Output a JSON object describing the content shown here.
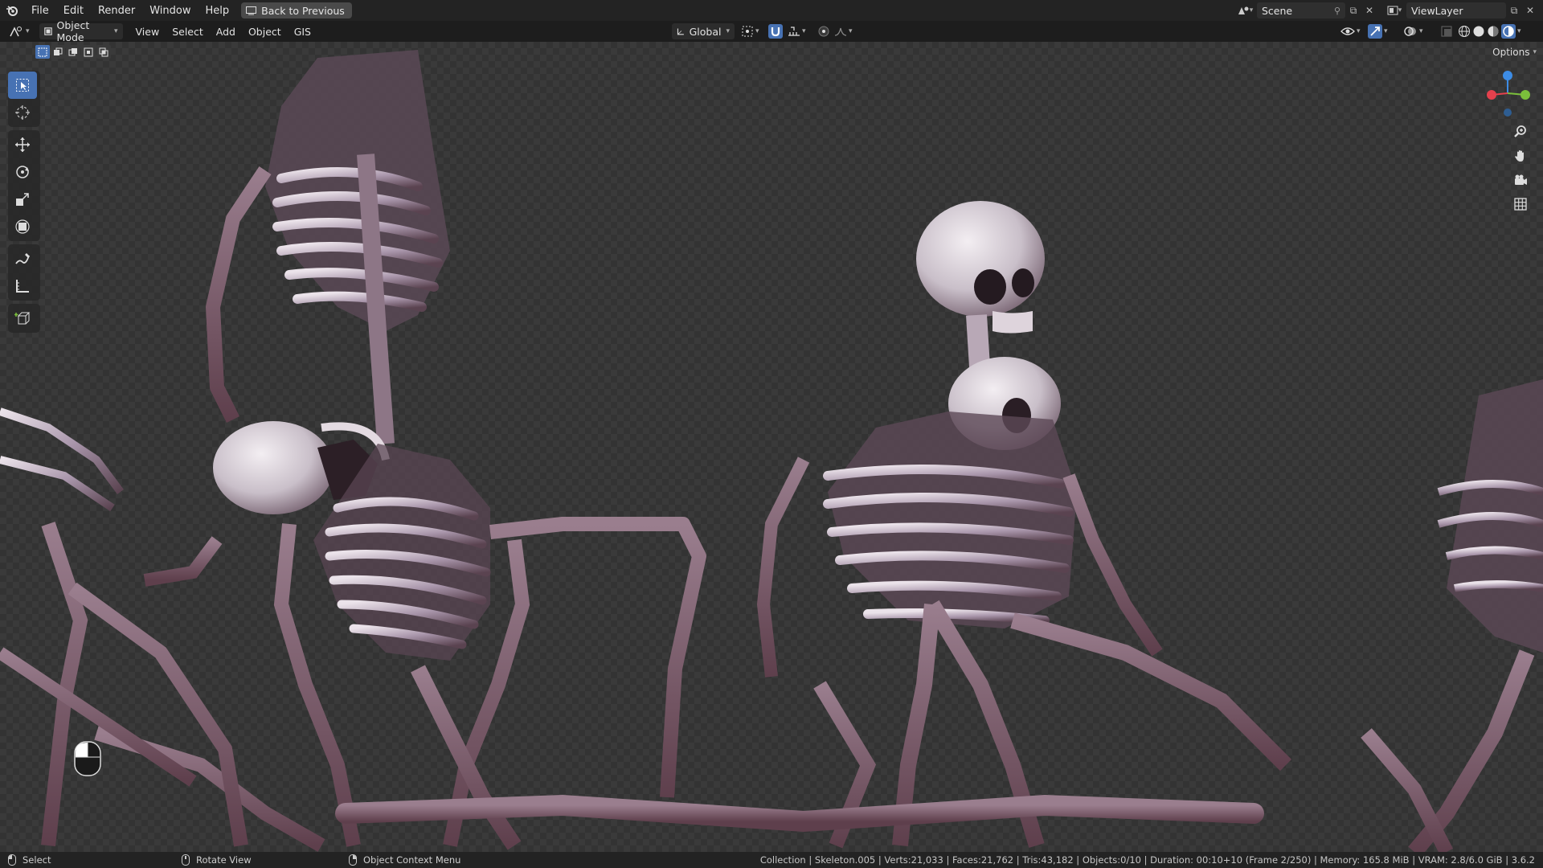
{
  "topbar": {
    "menus": [
      "File",
      "Edit",
      "Render",
      "Window",
      "Help"
    ],
    "back_button": "Back to Previous",
    "scene_name": "Scene",
    "view_layer_name": "ViewLayer"
  },
  "viewport_header": {
    "mode": "Object Mode",
    "menus": [
      "View",
      "Select",
      "Add",
      "Object",
      "GIS"
    ],
    "transform_orientation": "Global"
  },
  "options_label": "Options",
  "gizmo": {
    "x_color": "#e5414d",
    "y_color": "#7bbf3b",
    "z_color": "#3d8ce5"
  },
  "statusbar": {
    "select": "Select",
    "rotate": "Rotate View",
    "context": "Object Context Menu",
    "stats": "Collection | Skeleton.005 | Verts:21,033 | Faces:21,762 | Tris:43,182 | Objects:0/10 | Duration: 00:10+10 (Frame 2/250) | Memory: 165.8 MiB | VRAM: 2.8/6.0 GiB | 3.6.2"
  },
  "colors": {
    "accent": "#4772b3",
    "bone_light": "#e7dfe6",
    "bone_mid": "#a897a8",
    "bone_dark": "#5b4552"
  },
  "icons": [
    "blender-logo",
    "select-box-icon",
    "cursor-icon",
    "move-icon",
    "rotate-icon",
    "scale-icon",
    "transform-icon",
    "annotate-icon",
    "measure-icon",
    "add-cube-icon",
    "zoom-icon",
    "hand-pan-icon",
    "camera-icon",
    "grid-icon"
  ]
}
